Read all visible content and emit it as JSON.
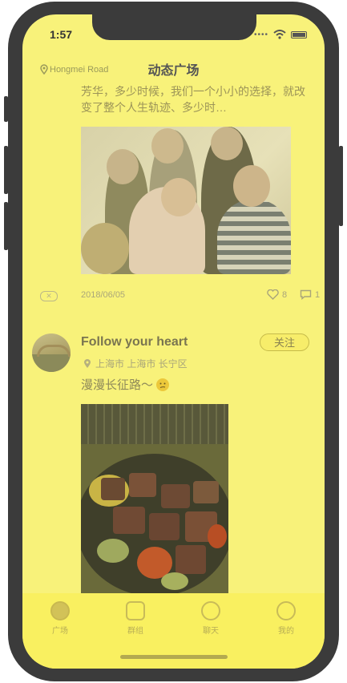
{
  "status": {
    "time": "1:57"
  },
  "header": {
    "location": "Hongmei Road",
    "title": "动态广场"
  },
  "post1": {
    "text": "芳华，多少时候，我们一个小小的选择，就改变了整个人生轨迹、多少时…",
    "tag": "✕",
    "date": "2018/06/05",
    "likes": "8",
    "comments": "1"
  },
  "post2": {
    "username": "Follow your heart",
    "follow_label": "关注",
    "location": "上海市 上海市 长宁区",
    "text": "漫漫长征路～"
  },
  "tabbar": {
    "items": [
      {
        "label": "广场"
      },
      {
        "label": "群组"
      },
      {
        "label": "聊天"
      },
      {
        "label": "我的"
      }
    ]
  },
  "colors": {
    "overlay": "#f8f27a",
    "frame": "#3b3b3b",
    "accent": "#c6bb4a"
  }
}
